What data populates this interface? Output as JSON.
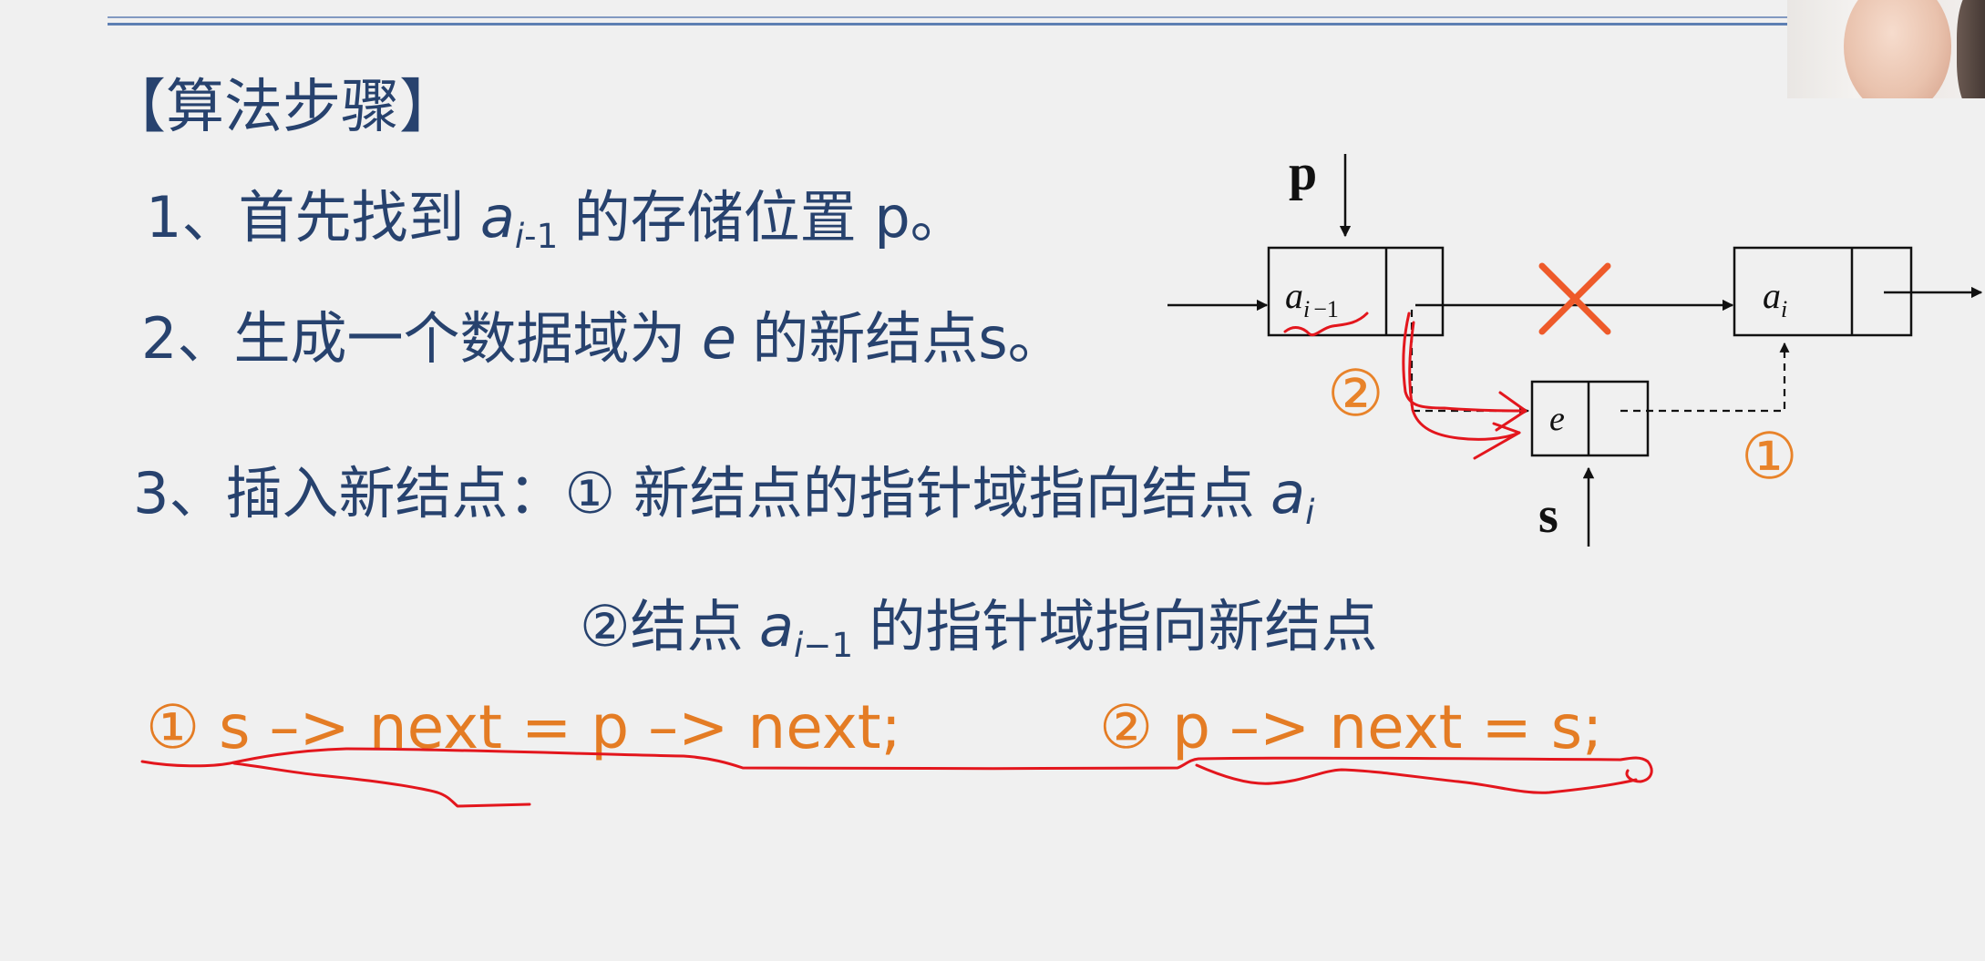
{
  "colors": {
    "text": "#27426e",
    "code": "#e47c24",
    "annotation": "#e3161d",
    "cross": "#ee5a2a",
    "rule": "#5d7fb3"
  },
  "title": "【算法步骤】",
  "step1": {
    "before": "1、首先找到",
    "var": "a",
    "sub": "i",
    "sub_offset": "-1",
    "after": "的存储位置 p。"
  },
  "step2": {
    "before": "2、生成一个数据域为",
    "var": "e",
    "after": "的新结点s。"
  },
  "step3": {
    "before": "3、插入新结点：① 新结点的指针域指向结点",
    "var": "a",
    "sub": "i"
  },
  "step3_detail": {
    "before": "②结点",
    "var": "a",
    "sub": "i",
    "sub_offset": "−1",
    "after": "的指针域指向新结点"
  },
  "code": {
    "first": "① s –> next = p –> next;",
    "second": "② p –> next = s;"
  },
  "diagram": {
    "pointer_p": "p",
    "pointer_s": "s",
    "node_prev": {
      "var": "a",
      "sub": "i",
      "sub_offset": "−1"
    },
    "node_new": {
      "var": "e"
    },
    "node_next": {
      "var": "a",
      "sub": "i"
    },
    "label_step_1": "①",
    "label_step_2": "②"
  }
}
